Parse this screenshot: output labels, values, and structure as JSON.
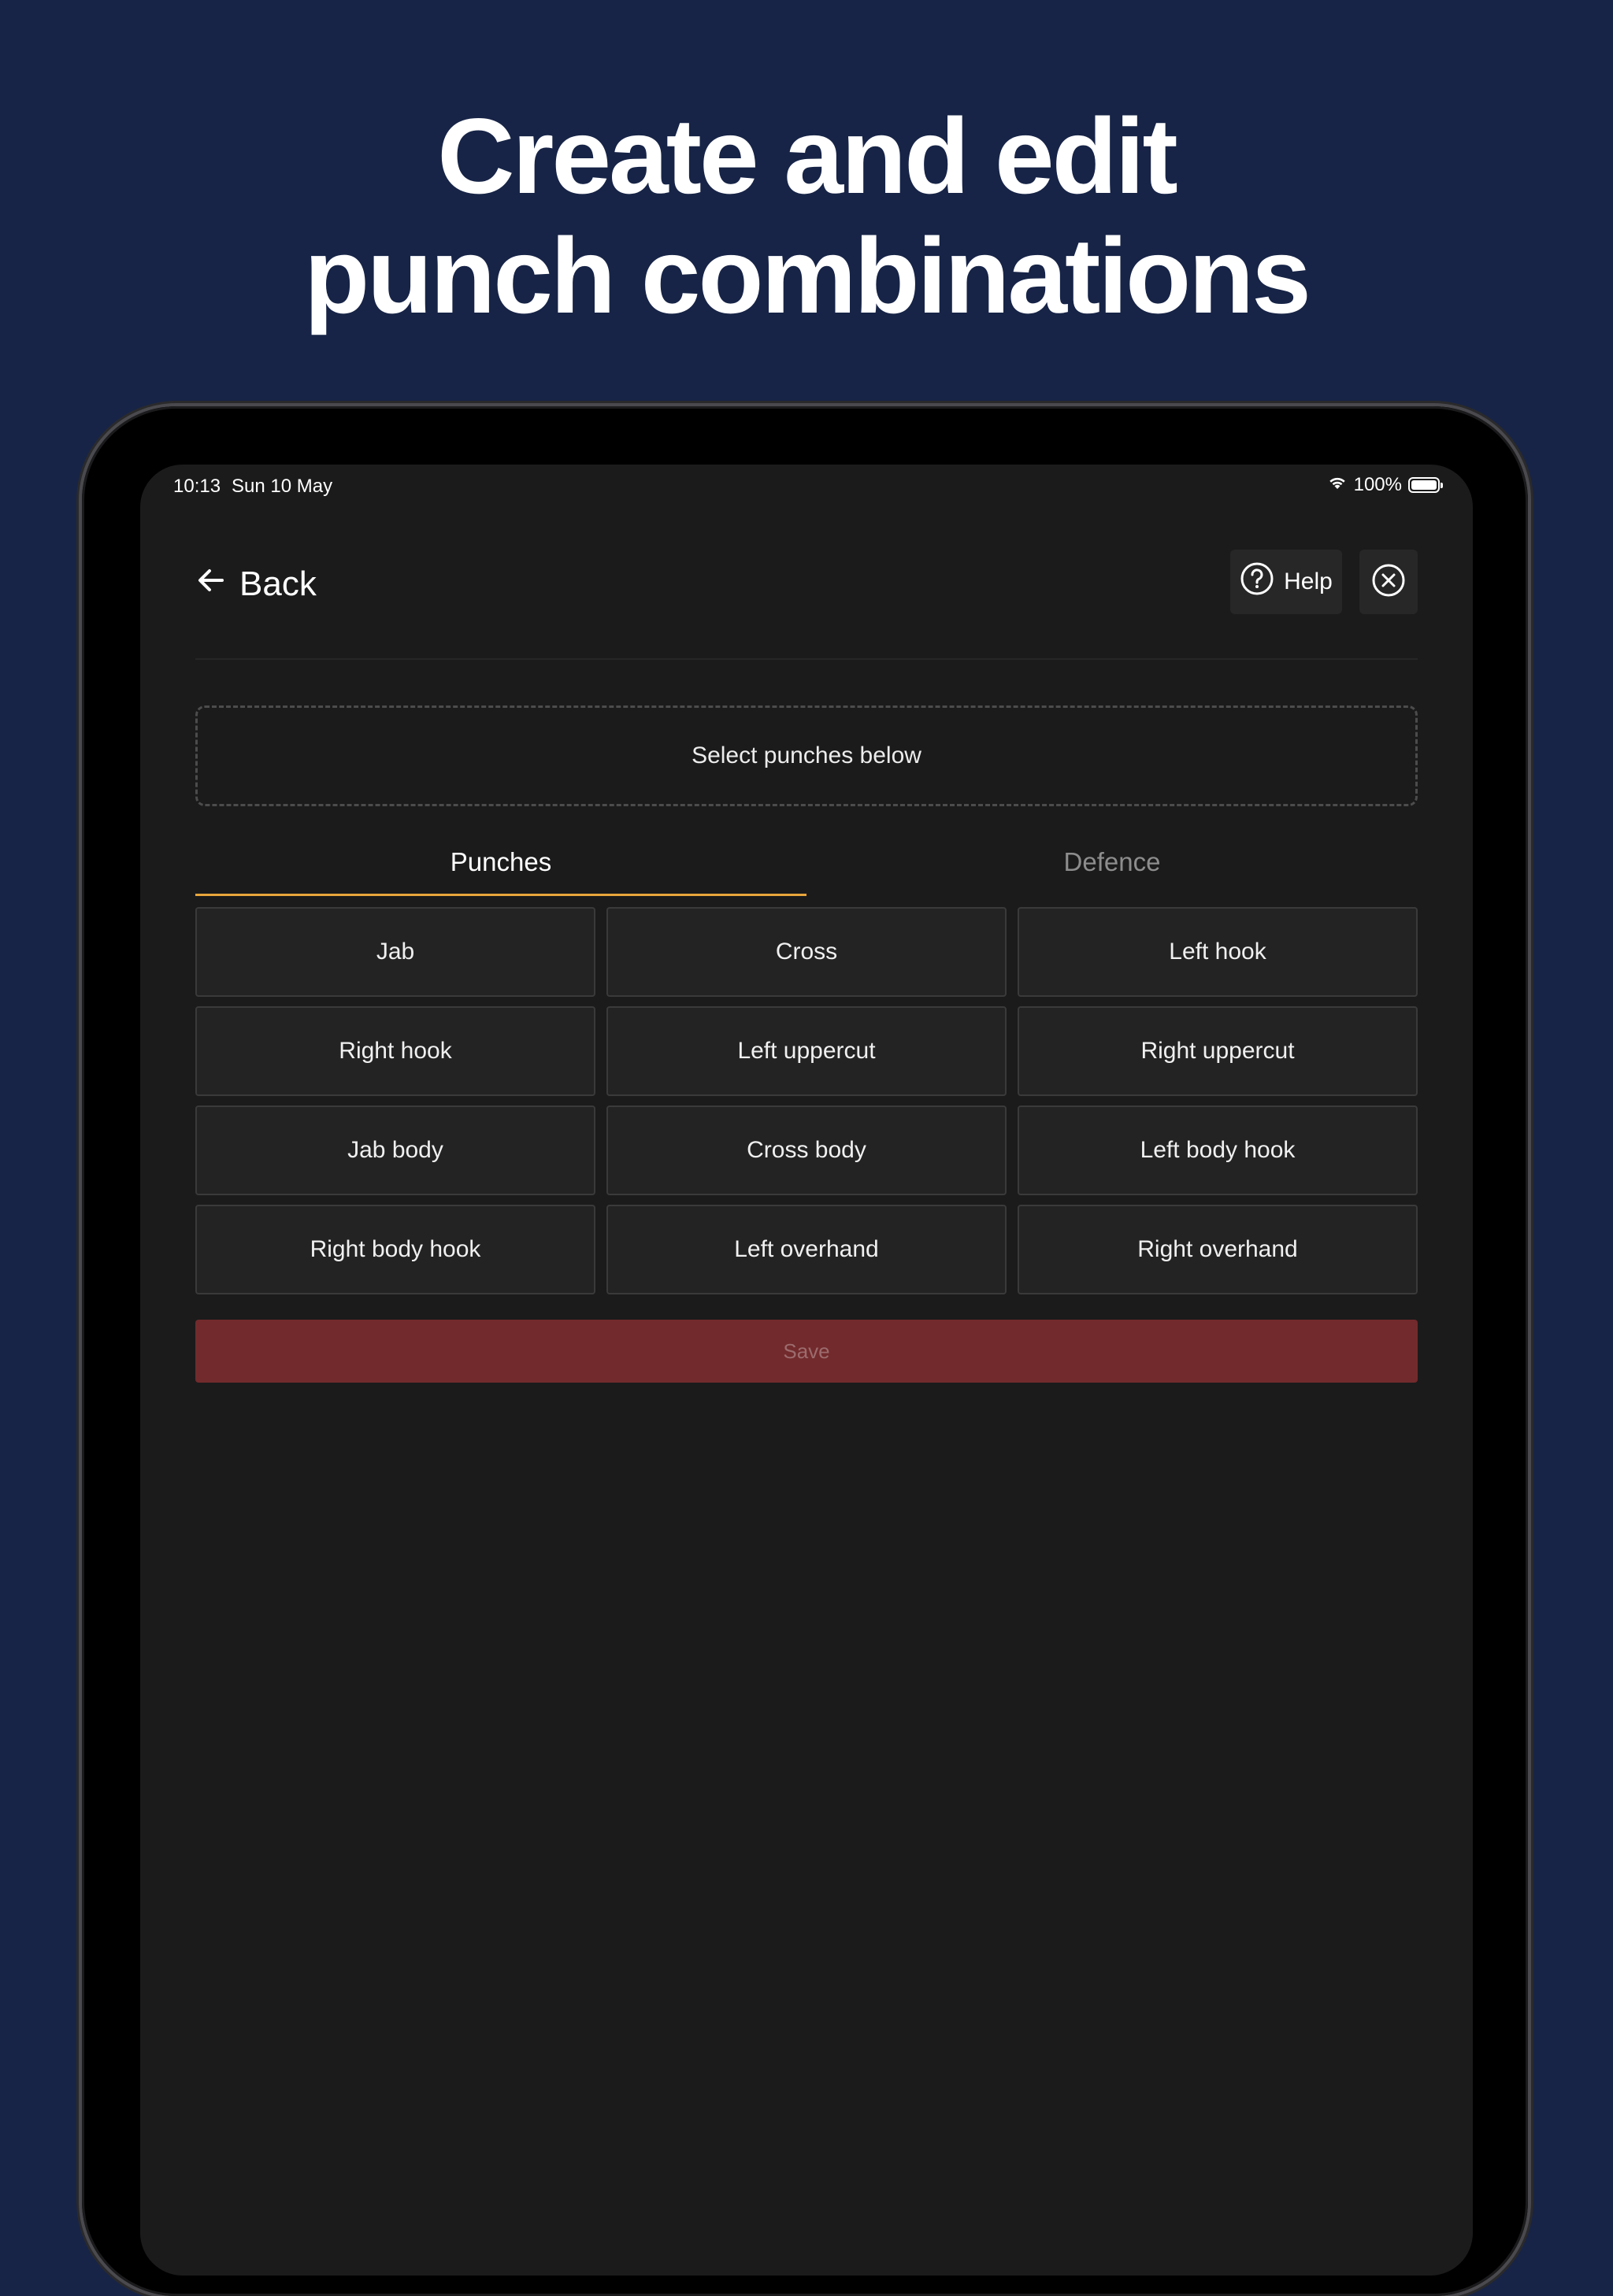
{
  "headline": {
    "line1": "Create and edit",
    "line2": "punch combinations"
  },
  "status_bar": {
    "time": "10:13",
    "date": "Sun 10 May",
    "battery": "100%"
  },
  "header": {
    "back_label": "Back",
    "help_label": "Help"
  },
  "dropzone": {
    "text": "Select punches below"
  },
  "tabs": [
    {
      "label": "Punches",
      "active": true
    },
    {
      "label": "Defence",
      "active": false
    }
  ],
  "punches": [
    "Jab",
    "Cross",
    "Left hook",
    "Right hook",
    "Left uppercut",
    "Right uppercut",
    "Jab body",
    "Cross body",
    "Left body hook",
    "Right body hook",
    "Left overhand",
    "Right overhand"
  ],
  "save_label": "Save",
  "colors": {
    "background": "#172447",
    "screen": "#1b1b1b",
    "tab_accent": "#e8a63a",
    "save_button": "#722a2c"
  }
}
